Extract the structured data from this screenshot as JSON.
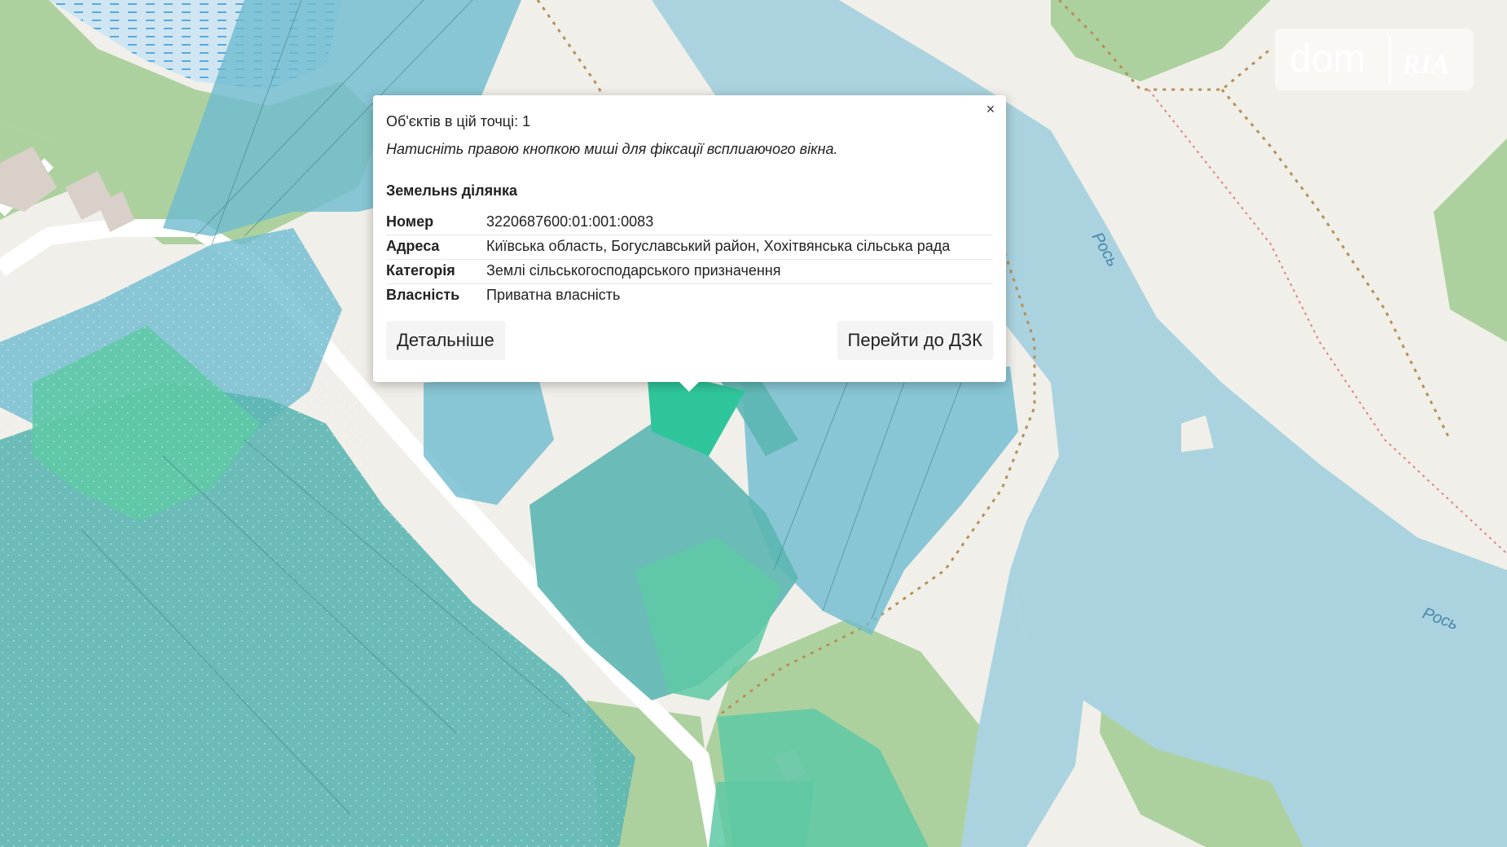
{
  "popup": {
    "count_text": "Об'єктів в цій точці: 1",
    "hint": "Натисніть правою кнопкою миші для фіксації всплиаючого вікна.",
    "section_title": "Земельнs ділянка",
    "rows": [
      {
        "key": "Номер",
        "value": "3220687600:01:001:0083"
      },
      {
        "key": "Адреса",
        "value": "Київська область, Богуславський район, Хохітвянська сільська рада"
      },
      {
        "key": "Категорія",
        "value": "Землі сільськогосподарського призначення"
      },
      {
        "key": "Власність",
        "value": "Приватна власність"
      }
    ],
    "details_label": "Детальніше",
    "dzk_label": "Перейти до ДЗК",
    "close_symbol": "×"
  },
  "map": {
    "river_labels": [
      "Рось",
      "Рось"
    ],
    "colors": {
      "background": "#f1efe9",
      "forest": "#add19e",
      "water": "#aad3df",
      "parcel_blue": "#6ebcd0",
      "parcel_green": "#5ec9a5",
      "parcel_teal": "#5cb6b2",
      "parcel_selected": "#2fc59b"
    }
  },
  "logo": {
    "dom": "dom",
    "ria": "RIA"
  }
}
